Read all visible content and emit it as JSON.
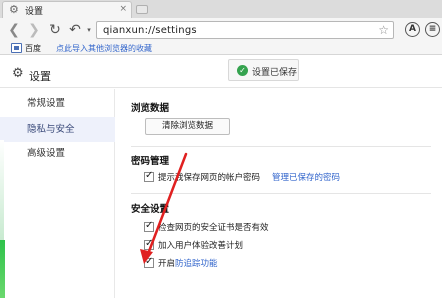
{
  "browser": {
    "tab": {
      "title": "设置",
      "icon": "gear-icon",
      "close": "×"
    },
    "address": {
      "url": "qianxun://settings"
    },
    "bookmarks": {
      "baidu": "百度",
      "import": "点此导入其他浏览器的收藏"
    }
  },
  "page": {
    "title": "设置",
    "toast": {
      "message": "设置已保存",
      "icon": "check-icon"
    },
    "sidebar": {
      "items": [
        {
          "label": "常规设置"
        },
        {
          "label": "隐私与安全"
        },
        {
          "label": "高级设置"
        }
      ]
    },
    "sections": {
      "browsing": {
        "title": "浏览数据",
        "clear_button": "清除浏览数据"
      },
      "passwords": {
        "title": "密码管理",
        "save_option": "提示我保存网页的帐户密码",
        "manage_link": "管理已保存的密码"
      },
      "security": {
        "title": "安全设置",
        "cert_check": "检查网页的安全证书是否有效",
        "ux_plan": "加入用户体验改善计划",
        "anti_track_prefix": "开启",
        "anti_track_highlight": "防追踪功能"
      }
    }
  },
  "colors": {
    "accent": "#3366cc",
    "arrow": "#e02020",
    "toast_ok": "#35a34f"
  }
}
